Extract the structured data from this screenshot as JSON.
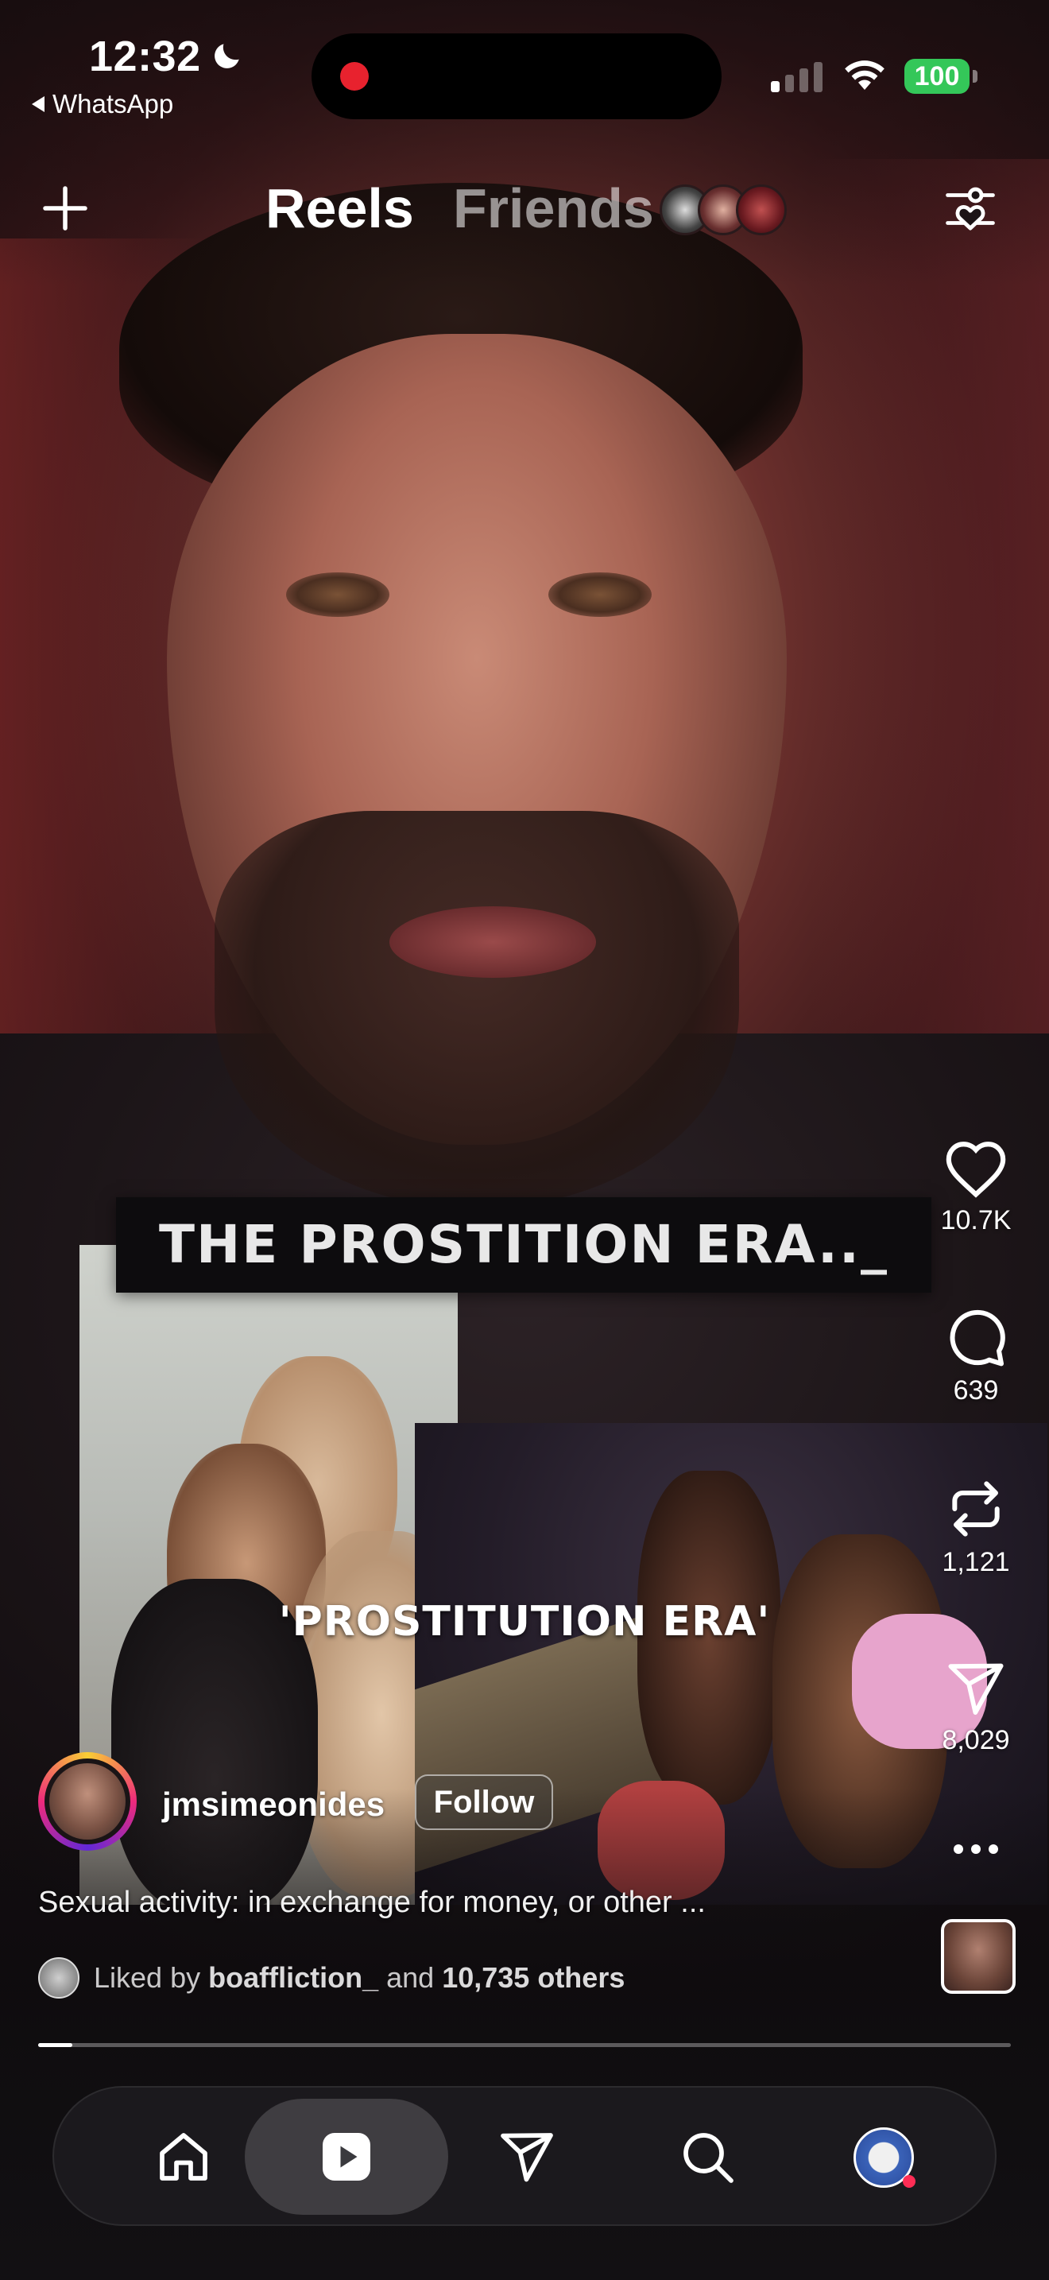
{
  "status_bar": {
    "time": "12:32",
    "back_app": "WhatsApp",
    "battery": "100",
    "battery_color": "#34c759",
    "recording_color": "#e8222e"
  },
  "header": {
    "tabs": [
      {
        "label": "Reels",
        "active": true
      },
      {
        "label": "Friends",
        "active": false
      }
    ],
    "icons": {
      "left": "plus-icon",
      "right": "filter-heart-icon"
    }
  },
  "video": {
    "caption_top": "THE PROSTITION ERA.._",
    "caption_mid": "'PROSTITUTION ERA'"
  },
  "actions": [
    {
      "icon": "heart-icon",
      "count": "10.7K"
    },
    {
      "icon": "comment-icon",
      "count": "639"
    },
    {
      "icon": "repost-icon",
      "count": "1,121"
    },
    {
      "icon": "send-icon",
      "count": "8,029"
    },
    {
      "icon": "more-icon",
      "count": ""
    }
  ],
  "author": {
    "username": "jmsimeonides",
    "follow_label": "Follow"
  },
  "description": "Sexual activity: in exchange for money, or other ...",
  "liked_by": {
    "prefix": "Liked by",
    "user": "boaffliction_",
    "middle": "and",
    "others": "10,735 others"
  },
  "progress_fraction": 0.035,
  "nav": {
    "items": [
      "home-icon",
      "reels-icon",
      "send-icon",
      "search-icon",
      "profile-avatar"
    ],
    "active": "reels-icon",
    "notification_dot_color": "#ff2d55"
  }
}
